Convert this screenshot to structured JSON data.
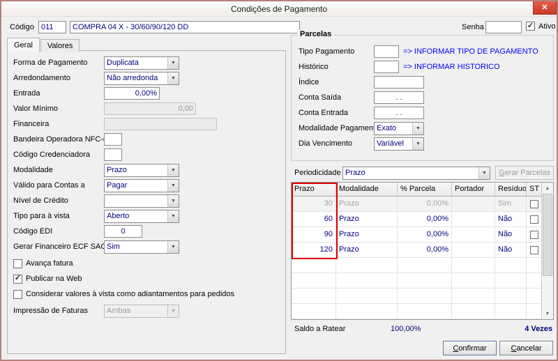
{
  "window": {
    "title": "Condições de Pagamento"
  },
  "icons": {
    "close": "✕",
    "dropdown": "▼",
    "check": "✓",
    "scroll_up": "▲",
    "scroll_down": "▼"
  },
  "colors": {
    "value_text": "#000080",
    "hint_text": "#0000ff",
    "highlight_border": "#dd0000",
    "close_button": "#c83a29",
    "window_border": "#b5837a"
  },
  "header": {
    "codigo_label": "Código",
    "codigo_value": "011",
    "descricao_value": "COMPRA 04 X - 30/60/90/120 DD",
    "senha_label": "Senha",
    "senha_value": "",
    "ativo": {
      "label": "Ativo",
      "mark": "✓"
    }
  },
  "tabs": [
    {
      "label": "Geral"
    },
    {
      "label": "Valores"
    }
  ],
  "geral": {
    "fields": [
      {
        "label": "Forma de Pagamento",
        "value": "Duplicata"
      },
      {
        "label": "Arredondamento",
        "value": "Não arredonda"
      },
      {
        "label": "Entrada",
        "value": "0,00%"
      },
      {
        "label": "Valor Mínimo",
        "value": "0,00"
      },
      {
        "label": "Financeira",
        "value": ""
      },
      {
        "label": "Bandeira Operadora NFC-e",
        "value": ""
      },
      {
        "label": "Código Credenciadora",
        "value": ""
      },
      {
        "label": "Modalidade",
        "value": "Prazo"
      },
      {
        "label": "Válido para Contas a",
        "value": "Pagar"
      },
      {
        "label": "Nível de Crédito",
        "value": ""
      },
      {
        "label": "Tipo para à vista",
        "value": "Aberto"
      },
      {
        "label": "Código EDI",
        "value": "0"
      },
      {
        "label": "Gerar Financeiro ECF SAC",
        "value": "Sim"
      }
    ],
    "checkboxes": [
      {
        "label": "Avança fatura",
        "mark": ""
      },
      {
        "label": "Publicar na Web",
        "mark": "✓"
      },
      {
        "label": "Considerar valores à vista como adiantamentos para pedidos",
        "mark": ""
      }
    ],
    "impressao": {
      "label": "Impressão de Faturas",
      "value": "Ambas"
    }
  },
  "parcelas": {
    "title": "Parcelas",
    "tipo_pagamento": {
      "label": "Tipo Pagamento",
      "value": "",
      "hint": "=> INFORMAR TIPO DE PAGAMENTO"
    },
    "historico": {
      "label": "Histórico",
      "value": "",
      "hint": "=> INFORMAR HISTORICO"
    },
    "indice": {
      "label": "Índice",
      "value": ""
    },
    "conta_saida": {
      "label": "Conta Saída",
      "value": ". ."
    },
    "conta_entrada": {
      "label": "Conta Entrada",
      "value": ". ."
    },
    "modalidade_pagamento": {
      "label": "Modalidade Pagamento",
      "value": "Exato"
    },
    "dia_vencimento": {
      "label": "Dia Vencimento",
      "value": "Variável"
    }
  },
  "periodicidade": {
    "label": "Periodicidade",
    "value": "Prazo",
    "gerar_button": "Gerar Parcelas"
  },
  "grid": {
    "columns": [
      "Prazo",
      "Modalidade",
      "% Parcela",
      "Portador",
      "Resíduo",
      "ST"
    ],
    "rows": [
      {
        "prazo": "30",
        "modalidade": "Prazo",
        "parcela": "0,00%",
        "portador": "",
        "residuo": "Sim",
        "st_mark": ""
      },
      {
        "prazo": "60",
        "modalidade": "Prazo",
        "parcela": "0,00%",
        "portador": "",
        "residuo": "Não",
        "st_mark": ""
      },
      {
        "prazo": "90",
        "modalidade": "Prazo",
        "parcela": "0,00%",
        "portador": "",
        "residuo": "Não",
        "st_mark": ""
      },
      {
        "prazo": "120",
        "modalidade": "Prazo",
        "parcela": "0,00%",
        "portador": "",
        "residuo": "Não",
        "st_mark": ""
      }
    ]
  },
  "footer": {
    "saldo_label": "Saldo a Ratear",
    "saldo_value": "100,00%",
    "vezes_value": "4 Vezes",
    "confirmar_button": "Confirmar",
    "cancelar_button": "Cancelar"
  }
}
